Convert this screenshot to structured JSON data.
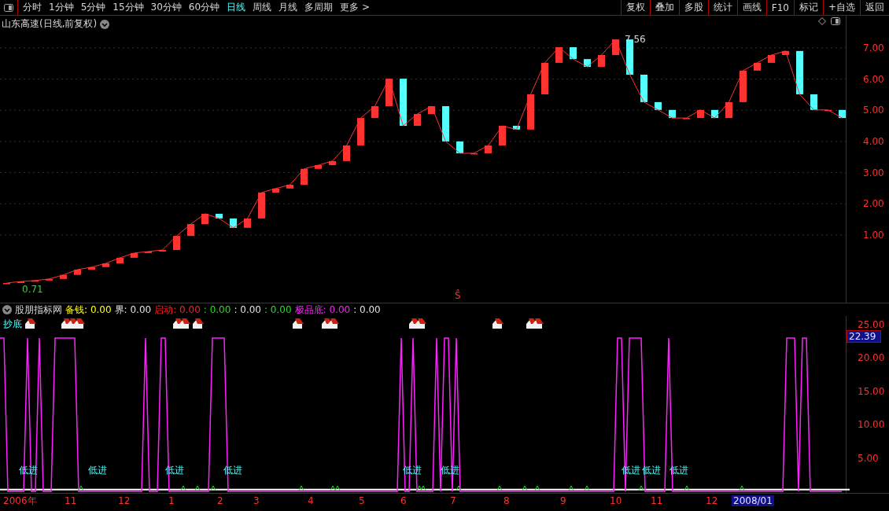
{
  "toolbar": {
    "tabs": [
      {
        "label": "分时",
        "selected": false
      },
      {
        "label": "1分钟",
        "selected": false
      },
      {
        "label": "5分钟",
        "selected": false
      },
      {
        "label": "15分钟",
        "selected": false
      },
      {
        "label": "30分钟",
        "selected": false
      },
      {
        "label": "60分钟",
        "selected": false
      },
      {
        "label": "日线",
        "selected": true
      },
      {
        "label": "周线",
        "selected": false
      },
      {
        "label": "月线",
        "selected": false
      },
      {
        "label": "多周期",
        "selected": false
      },
      {
        "label": "更多 >",
        "selected": false
      }
    ],
    "buttons": [
      "复权",
      "叠加",
      "多股",
      "统计",
      "画线",
      "F10",
      "标记",
      "+自选",
      "返回"
    ]
  },
  "price_panel": {
    "title": "山东高速(日线,前复权)",
    "high_label": "7.56",
    "low_label": "0.71",
    "signal_mark": "Ŝ",
    "chart_data": {
      "type": "line",
      "ylim": [
        -1.17,
        8.03
      ],
      "grid": true,
      "yticks": [
        {
          "value": 1,
          "label": "1.00"
        },
        {
          "value": 2,
          "label": "2.00"
        },
        {
          "value": 3,
          "label": "3.00"
        },
        {
          "value": 4,
          "label": "4.00"
        },
        {
          "value": 5,
          "label": "5.00"
        },
        {
          "value": 6,
          "label": "6.00"
        },
        {
          "value": 7,
          "label": "7.00"
        }
      ],
      "series": [
        {
          "color": "#ff3232",
          "values": [
            -0.54,
            -0.49,
            -0.46,
            -0.41,
            -0.28,
            -0.11,
            -0.03,
            0.09,
            0.27,
            0.42,
            0.47,
            0.52,
            0.97,
            1.35,
            1.68,
            1.53,
            1.23,
            1.53,
            2.36,
            2.49,
            2.61,
            3.12,
            3.24,
            3.37,
            3.87,
            4.75,
            5.13,
            6.01,
            4.5,
            4.88,
            5.13,
            4.0,
            3.62,
            3.62,
            3.87,
            4.5,
            4.38,
            5.51,
            6.52,
            7.02,
            6.64,
            6.39,
            6.77,
            7.27,
            6.14,
            5.26,
            5.01,
            4.75,
            4.75,
            5.01,
            4.75,
            5.26,
            6.27,
            6.52,
            6.77,
            6.9,
            5.51,
            5.01,
            5.01,
            4.75
          ]
        }
      ]
    }
  },
  "indicator": {
    "name": "股朋指标网",
    "legend": [
      {
        "label": "备钱:",
        "value": "0.00",
        "color": "#ffff00"
      },
      {
        "label": "界:",
        "value": "0.00",
        "color": "#e0e0e0"
      },
      {
        "label": "启动:",
        "value": "0.00",
        "color": "#ff2020"
      },
      {
        "label": ":",
        "value": "0.00",
        "color": "#20e020"
      },
      {
        "label": ":",
        "value": "0.00",
        "color": "#e0e0e0"
      },
      {
        "label": ":",
        "value": "0.00",
        "color": "#20e020"
      },
      {
        "label": "极品底:",
        "value": "0.00",
        "color": "#ff20ff"
      },
      {
        "label": ":",
        "value": "0.00",
        "color": "#e0e0e0"
      }
    ],
    "bottom_label": "抄底",
    "cursor_value": "22.39",
    "signals": [
      "低进",
      "低进",
      "低进",
      "低进",
      "低进",
      "低进",
      "低进",
      "低进",
      "低进"
    ],
    "chart_data": {
      "type": "line",
      "ylim": [
        -0.2,
        26.3
      ],
      "yticks": [
        {
          "value": 5,
          "label": "5.00"
        },
        {
          "value": 10,
          "label": "10.00"
        },
        {
          "value": 15,
          "label": "15.00"
        },
        {
          "value": 20,
          "label": "20.00"
        },
        {
          "value": 25,
          "label": "25.00"
        }
      ],
      "series": [
        {
          "color": "#ff20ff",
          "values": [
            23,
            23,
            0,
            0,
            0,
            0,
            0,
            23,
            0,
            0,
            23,
            0,
            0,
            0,
            23,
            23,
            23,
            23,
            23,
            23,
            0,
            0,
            0,
            0,
            0,
            0,
            0,
            0,
            0,
            0,
            0,
            0,
            0,
            0,
            0,
            0,
            0,
            23,
            0,
            0,
            0,
            23,
            23,
            0,
            0,
            0,
            0,
            0,
            0,
            0,
            0,
            0,
            0,
            0,
            23,
            23,
            23,
            23,
            0,
            0,
            0,
            0,
            0,
            0,
            0,
            0,
            0,
            0,
            0,
            0,
            0,
            0,
            0,
            0,
            0,
            0,
            0,
            0,
            0,
            0,
            0,
            0,
            0,
            0,
            0,
            0,
            0,
            0,
            0,
            0,
            0,
            0,
            0,
            0,
            0,
            0,
            0,
            0,
            0,
            0,
            0,
            0,
            23,
            0,
            0,
            23,
            0,
            0,
            0,
            0,
            0,
            23,
            0,
            23,
            23,
            0,
            23,
            0,
            0,
            0,
            0,
            0,
            0,
            0,
            0,
            0,
            0,
            0,
            0,
            0,
            0,
            0,
            0,
            0,
            0,
            0,
            0,
            0,
            0,
            0,
            0,
            0,
            0,
            0,
            0,
            0,
            0,
            0,
            0,
            0,
            0,
            0,
            0,
            0,
            0,
            0,
            0,
            23,
            23,
            0,
            23,
            23,
            23,
            23,
            0,
            0,
            0,
            0,
            0,
            0,
            23,
            0,
            0,
            0,
            0,
            0,
            0,
            0,
            0,
            0,
            0,
            0,
            0,
            0,
            0,
            0,
            0,
            0,
            0,
            0,
            0,
            0,
            0,
            0,
            0,
            0,
            0,
            0,
            0,
            0,
            23,
            23,
            23,
            0,
            23,
            23,
            0,
            0,
            0,
            0,
            0,
            0,
            0,
            0,
            0
          ]
        },
        {
          "color": "#ffffff",
          "values": [
            0.3,
            0.3,
            0.3,
            0.3,
            0.3,
            0.3,
            0.3,
            0.3,
            0.3,
            0.3,
            0.3,
            0.3,
            0.3,
            0.3,
            0.3,
            0.3,
            0.3,
            0.3,
            0.3,
            0.3,
            0.3,
            0.3,
            0.3,
            0.3,
            0.3,
            0.3,
            0.3,
            0.3,
            0.3,
            0.3,
            0.3,
            0.3,
            0.3,
            0.3,
            0.3,
            0.3,
            0.3,
            0.3,
            0.3,
            0.3,
            0.3,
            0.3,
            0.3,
            0.3,
            0.3,
            0.3,
            0.3,
            0.3,
            0.3,
            0.3,
            0.3,
            0.3,
            0.3,
            0.3,
            0.3,
            0.3,
            0.3,
            0.3,
            0.3,
            0.3,
            0.3,
            0.3,
            0.3,
            0.3,
            0.3,
            0.3,
            0.3,
            0.3,
            0.3,
            0.3,
            0.3,
            0.3,
            0.3,
            0.3,
            0.3,
            0.3,
            0.3,
            0.3,
            0.3,
            0.3,
            0.3,
            0.3,
            0.3,
            0.3,
            0.3,
            0.3,
            0.3,
            0.3,
            0.3,
            0.3,
            0.3,
            0.3,
            0.3,
            0.3,
            0.3,
            0.3,
            0.3,
            0.3,
            0.3,
            0.3,
            0.3,
            0.3,
            0.3,
            0.3,
            0.3,
            0.3,
            0.3,
            0.3,
            0.3,
            0.3,
            0.3,
            0.3,
            0.3,
            0.3,
            0.3,
            0.3,
            0.3,
            0.3,
            0.3,
            0.3,
            0.3,
            0.3,
            0.3,
            0.3,
            0.3,
            0.3,
            0.3,
            0.3,
            0.3,
            0.3,
            0.3,
            0.3,
            0.3,
            0.3,
            0.3,
            0.3,
            0.3,
            0.3,
            0.3,
            0.3,
            0.3,
            0.3,
            0.3,
            0.3,
            0.3,
            0.3,
            0.3,
            0.3,
            0.3,
            0.3,
            0.3,
            0.3,
            0.3,
            0.3,
            0.3,
            0.3,
            0.3,
            0.3,
            0.3,
            0.3,
            0.3,
            0.3,
            0.3,
            0.3,
            0.3,
            0.3,
            0.3,
            0.3,
            0.3,
            0.3,
            0.3,
            0.3,
            0.3,
            0.3,
            0.3,
            0.3,
            0.3,
            0.3,
            0.3,
            0.3,
            0.3,
            0.3,
            0.3,
            0.3,
            0.3,
            0.3,
            0.3,
            0.3,
            0.3,
            0.3,
            0.3,
            0.3,
            0.3,
            0.3,
            0.3,
            0.3,
            0.3,
            0.3,
            0.3,
            0.3,
            0.3,
            0.3,
            0.3,
            0.3,
            0.3,
            0.3,
            0.3,
            0.3,
            0.3,
            0.3,
            0.3,
            0.3,
            0.3,
            0.3,
            0.3,
            0.3,
            0.3
          ]
        }
      ]
    }
  },
  "date_axis": [
    {
      "label": "2006年",
      "selected": false
    },
    {
      "label": "11",
      "selected": false
    },
    {
      "label": "12",
      "selected": false
    },
    {
      "label": "1",
      "selected": false
    },
    {
      "label": "2",
      "selected": false
    },
    {
      "label": "3",
      "selected": false
    },
    {
      "label": "4",
      "selected": false
    },
    {
      "label": "5",
      "selected": false
    },
    {
      "label": "6",
      "selected": false
    },
    {
      "label": "7",
      "selected": false
    },
    {
      "label": "8",
      "selected": false
    },
    {
      "label": "9",
      "selected": false
    },
    {
      "label": "10",
      "selected": false
    },
    {
      "label": "11",
      "selected": false
    },
    {
      "label": "12",
      "selected": false
    },
    {
      "label": "2008/01",
      "selected": true
    }
  ]
}
